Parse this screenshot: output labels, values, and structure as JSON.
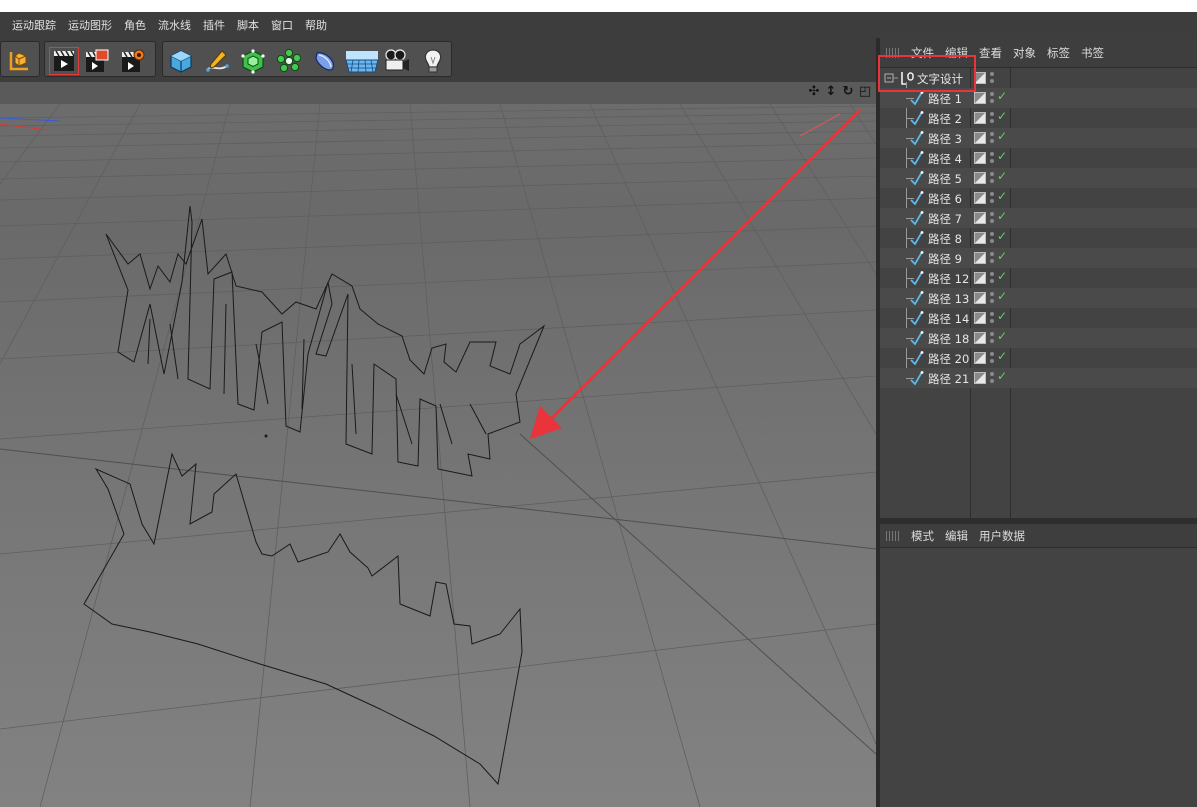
{
  "menubar": {
    "items": [
      "运动跟踪",
      "运动图形",
      "角色",
      "流水线",
      "插件",
      "脚本",
      "窗口",
      "帮助"
    ]
  },
  "toolbar": {
    "icons": [
      "coordinate-axis-icon",
      "object-cube-icon",
      "render-view-icon",
      "render-picture-viewer-icon",
      "render-settings-icon",
      "cube-primitive-icon",
      "pen-spline-icon",
      "subdivision-surface-icon",
      "cloner-icon",
      "deformer-icon",
      "floor-scene-icon",
      "camera-icon",
      "light-icon"
    ]
  },
  "viewport": {
    "nav_icons": [
      "move-view-icon",
      "zoom-view-icon",
      "rotate-view-icon",
      "maximize-view-icon"
    ],
    "nav_glyphs": [
      "✣",
      "↕",
      "↻",
      "◰"
    ]
  },
  "object_manager": {
    "menu": [
      "文件",
      "编辑",
      "查看",
      "对象",
      "标签",
      "书签"
    ],
    "root": {
      "name": "文字设计",
      "icon": "null-object-icon"
    },
    "children": [
      "路径 1",
      "路径 2",
      "路径 3",
      "路径 4",
      "路径 5",
      "路径 6",
      "路径 7",
      "路径 8",
      "路径 9",
      "路径 12",
      "路径 13",
      "路径 14",
      "路径 18",
      "路径 20",
      "路径 21"
    ]
  },
  "attribute_manager": {
    "menu": [
      "模式",
      "编辑",
      "用户数据"
    ]
  },
  "colors": {
    "highlight_box": "#e8343a",
    "arrow": "#e8343a",
    "check": "#5fd35f",
    "spline_icon": "#5fb8e6"
  }
}
